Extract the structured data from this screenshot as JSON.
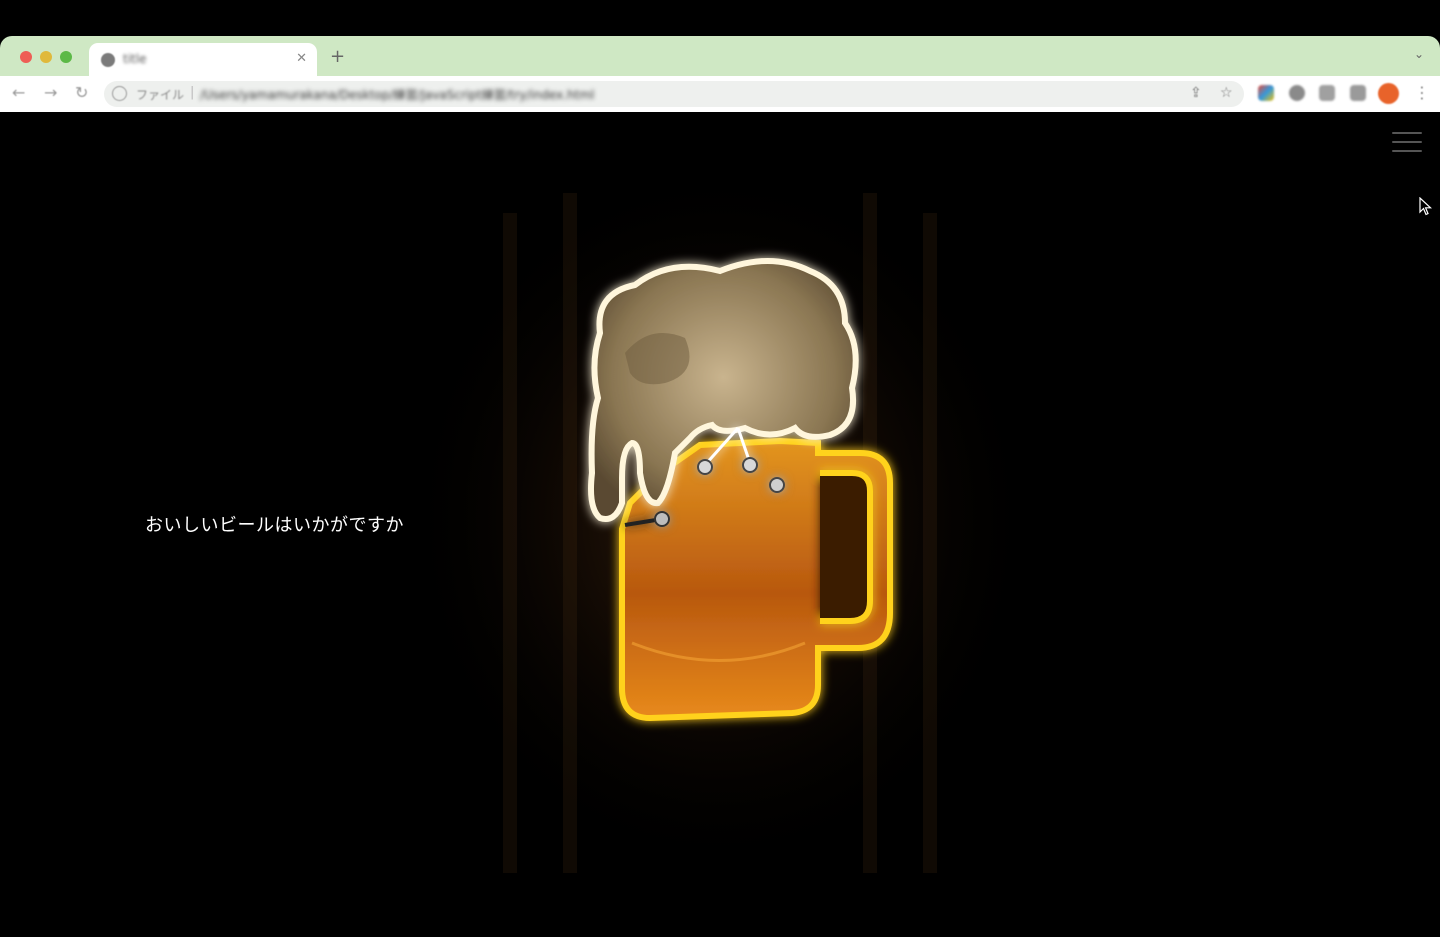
{
  "browser": {
    "tab": {
      "title": "title"
    },
    "address_bar": {
      "scheme_label": "ファイル",
      "url": "/Users/yamamurakana/Desktop/練習/JavaScript練習/try/index.html"
    }
  },
  "page": {
    "tagline": "おいしいビールはいかがですか",
    "hero_image": "neon-beer-mug-sign",
    "menu_icon": "hamburger-menu-icon"
  },
  "colors": {
    "tab_strip": "#cfe8c4",
    "page_background": "#000000",
    "neon_outline": "#ffd21a",
    "beer": "#d9831c",
    "foam": "#cdbb98"
  }
}
